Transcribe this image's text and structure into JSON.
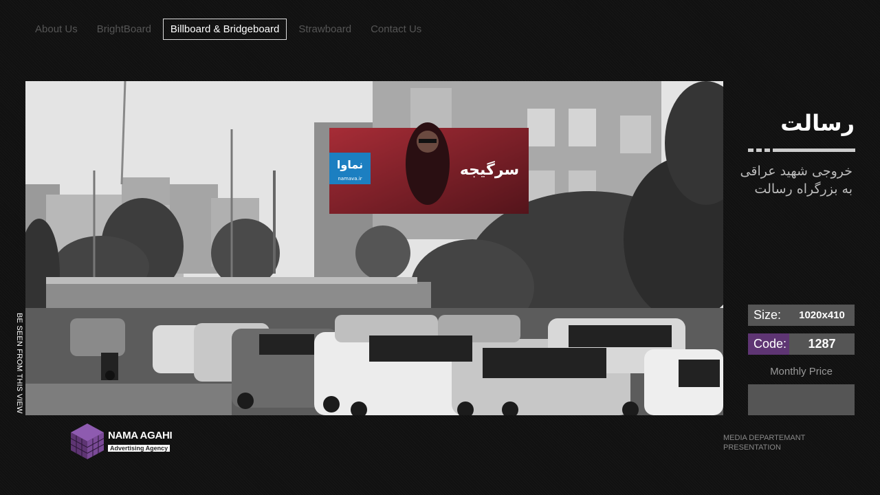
{
  "nav": {
    "items": [
      "About Us",
      "BrightBoard",
      "Billboard & Bridgeboard",
      "Strawboard",
      "Contact Us"
    ],
    "active_index": 2
  },
  "photo": {
    "side_caption": "BE SEEN FROM THIS VIEW",
    "billboard_brand": "نماوا",
    "billboard_url": "namava.ir",
    "billboard_title": "سرگیجه"
  },
  "location": {
    "title": "رسالت",
    "subtitle_line1": "خروجی شهید عراقی",
    "subtitle_line2": "به بزرگراه  رسالت"
  },
  "specs": {
    "size_label": "Size:",
    "size_value": "1020x410",
    "code_label": "Code:",
    "code_value": "1287",
    "price_label": "Monthly Price",
    "price_value": ""
  },
  "footer": {
    "logo_name": "NAMA AGAHI",
    "logo_tagline": "Advertising Agency",
    "dept_line1": "MEDIA DEPARTEMANT",
    "dept_line2": "PRESENTATION"
  },
  "colors": {
    "accent_purple": "#5e3573",
    "panel_gray": "#555555",
    "billboard_blue": "#1c7fc1",
    "billboard_red": "#a02030"
  }
}
